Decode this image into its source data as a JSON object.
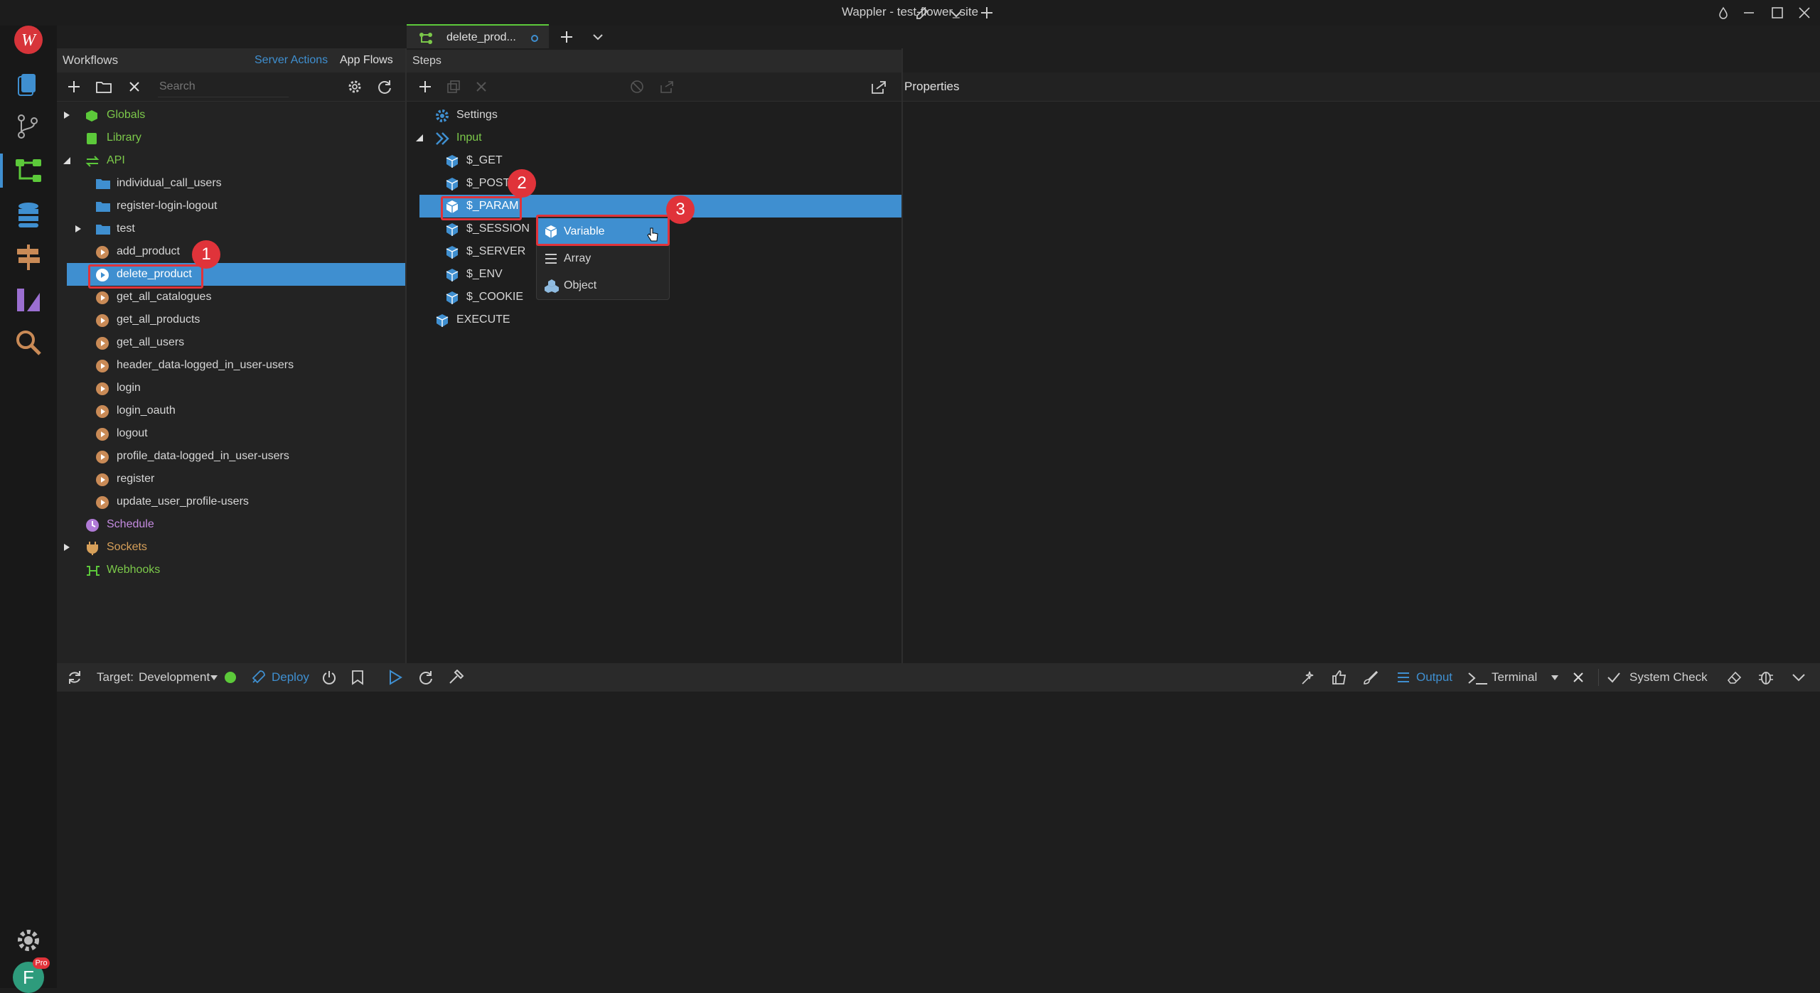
{
  "window": {
    "title": "Wappler - test-flower_site"
  },
  "tab": {
    "label": "delete_prod..."
  },
  "workflows": {
    "header": "Workflows",
    "tab_server_actions": "Server Actions",
    "tab_app_flows": "App Flows",
    "search_placeholder": "Search",
    "tree": [
      {
        "label": "Globals",
        "color": "#7cc94a"
      },
      {
        "label": "Library",
        "color": "#7cc94a"
      },
      {
        "label": "API",
        "color": "#7cc94a"
      },
      {
        "label": "individual_call_users"
      },
      {
        "label": "register-login-logout"
      },
      {
        "label": "test"
      },
      {
        "label": "add_product"
      },
      {
        "label": "delete_product"
      },
      {
        "label": "get_all_catalogues"
      },
      {
        "label": "get_all_products"
      },
      {
        "label": "get_all_users"
      },
      {
        "label": "header_data-logged_in_user-users"
      },
      {
        "label": "login"
      },
      {
        "label": "login_oauth"
      },
      {
        "label": "logout"
      },
      {
        "label": "profile_data-logged_in_user-users"
      },
      {
        "label": "register"
      },
      {
        "label": "update_user_profile-users"
      },
      {
        "label": "Schedule",
        "color": "#c48be0"
      },
      {
        "label": "Sockets",
        "color": "#d7a05a"
      },
      {
        "label": "Webhooks",
        "color": "#7cc94a"
      }
    ]
  },
  "steps": {
    "header": "Steps",
    "items": [
      {
        "label": "Settings"
      },
      {
        "label": "Input"
      },
      {
        "label": "$_GET"
      },
      {
        "label": "$_POST"
      },
      {
        "label": "$_PARAM"
      },
      {
        "label": "$_SESSION"
      },
      {
        "label": "$_SERVER"
      },
      {
        "label": "$_ENV"
      },
      {
        "label": "$_COOKIE"
      },
      {
        "label": "EXECUTE"
      }
    ]
  },
  "context_menu": {
    "items": [
      {
        "label": "Variable"
      },
      {
        "label": "Array"
      },
      {
        "label": "Object"
      }
    ]
  },
  "properties": {
    "header": "Properties"
  },
  "bottom": {
    "target_label": "Target:",
    "target_value": "Development",
    "deploy": "Deploy",
    "output": "Output",
    "terminal": "Terminal",
    "system_check": "System Check"
  },
  "markers": [
    "1",
    "2",
    "3"
  ],
  "user": {
    "avatar_letter": "F",
    "badge": "Pro"
  },
  "colors": {
    "accent": "#3f8fd0",
    "marker": "#e0333a",
    "status_ok": "#5cc93a"
  }
}
